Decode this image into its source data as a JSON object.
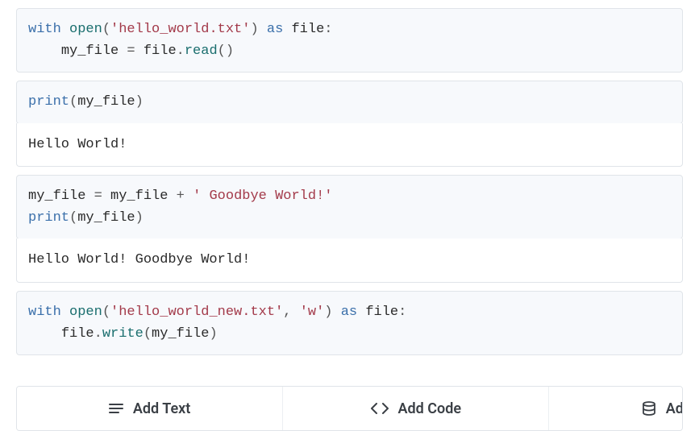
{
  "cells": {
    "c1": {
      "l1_kw_with": "with",
      "l1_fn_open": "open",
      "l1_pn_lp": "(",
      "l1_str": "'hello_world.txt'",
      "l1_pn_rp": ")",
      "l1_kw_as": "as",
      "l1_nm_file": "file",
      "l1_pn_colon": ":",
      "l2_indent": "    ",
      "l2_nm_myfile": "my_file",
      "l2_pn_assign": " = ",
      "l2_nm_file": "file",
      "l2_pn_dot": ".",
      "l2_fn_read": "read",
      "l2_pn_par": "()"
    },
    "c2": {
      "l1_kw_print": "print",
      "l1_pn_lp": "(",
      "l1_nm": "my_file",
      "l1_pn_rp": ")"
    },
    "out2": "Hello World!",
    "c3": {
      "l1_nm_lhs": "my_file",
      "l1_pn_assign": " = ",
      "l1_nm_rhs": "my_file",
      "l1_pn_plus": " + ",
      "l1_str": "' Goodbye World!'",
      "l2_kw_print": "print",
      "l2_pn_lp": "(",
      "l2_nm": "my_file",
      "l2_pn_rp": ")"
    },
    "out3": "Hello World! Goodbye World!",
    "c4": {
      "l1_kw_with": "with",
      "l1_fn_open": "open",
      "l1_pn_lp": "(",
      "l1_str1": "'hello_world_new.txt'",
      "l1_pn_comma": ", ",
      "l1_str2": "'w'",
      "l1_pn_rp": ")",
      "l1_kw_as": "as",
      "l1_nm_file": "file",
      "l1_pn_colon": ":",
      "l2_indent": "    ",
      "l2_nm_file": "file",
      "l2_pn_dot": ".",
      "l2_fn_write": "write",
      "l2_pn_lp": "(",
      "l2_nm_arg": "my_file",
      "l2_pn_rp": ")"
    }
  },
  "toolbar": {
    "add_text": "Add Text",
    "add_code": "Add Code",
    "add_more": "Add"
  }
}
